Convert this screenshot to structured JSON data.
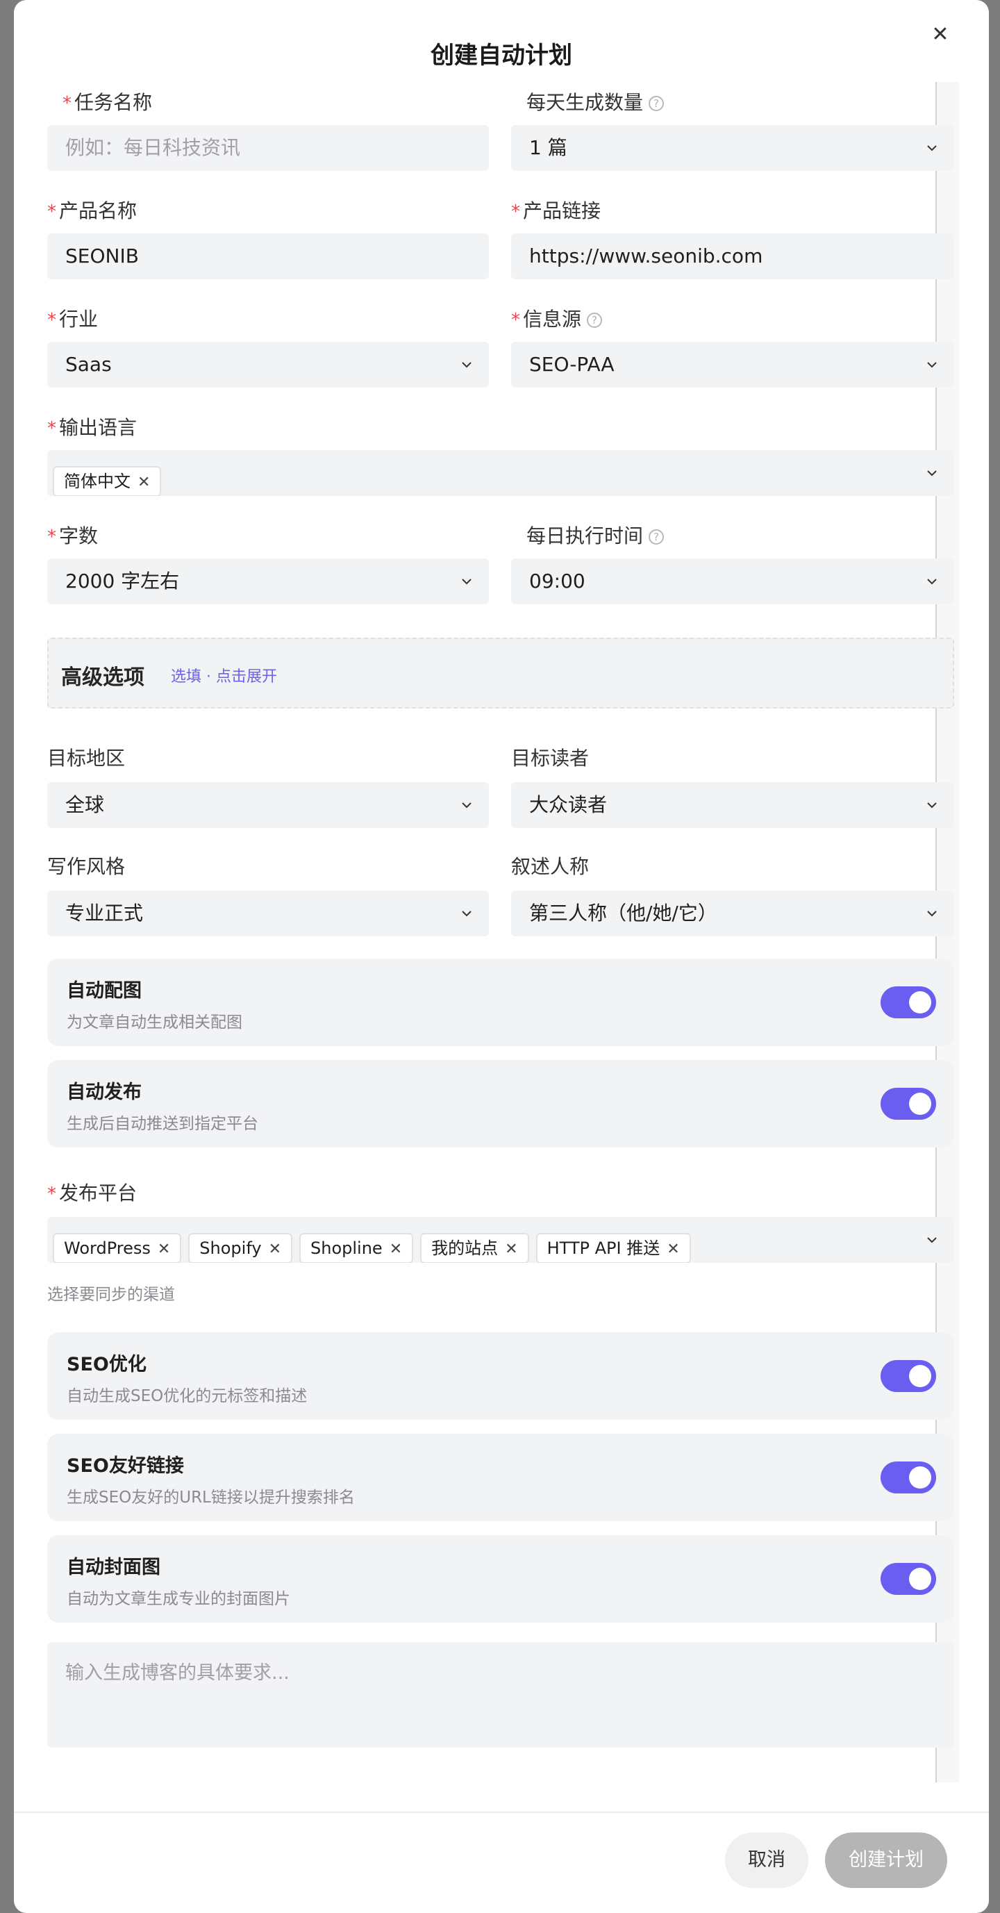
{
  "dialog": {
    "title": "创建自动计划",
    "close_icon": "close-icon"
  },
  "form": {
    "task_name": {
      "label": "任务名称",
      "placeholder": "例如：每日科技资讯"
    },
    "daily_count": {
      "label": "每天生成数量",
      "value": "1 篇"
    },
    "product_name": {
      "label": "产品名称",
      "value": "SEONIB"
    },
    "product_link": {
      "label": "产品链接",
      "value": "https://www.seonib.com"
    },
    "industry": {
      "label": "行业",
      "value": "Saas"
    },
    "source": {
      "label": "信息源",
      "value": "SEO-PAA"
    },
    "output_language": {
      "label": "输出语言",
      "tags": [
        "简体中文"
      ]
    },
    "word_count": {
      "label": "字数",
      "value": "2000 字左右"
    },
    "daily_time": {
      "label": "每日执行时间",
      "value": "09:00"
    }
  },
  "advanced": {
    "title": "高级选项",
    "hint": "选填 · 点击展开",
    "target_region": {
      "label": "目标地区",
      "value": "全球"
    },
    "target_reader": {
      "label": "目标读者",
      "value": "大众读者"
    },
    "writing_style": {
      "label": "写作风格",
      "value": "专业正式"
    },
    "narrator": {
      "label": "叙述人称",
      "value": "第三人称（他/她/它）"
    }
  },
  "toggles": [
    {
      "title": "自动配图",
      "subtitle": "为文章自动生成相关配图",
      "on": true
    },
    {
      "title": "自动发布",
      "subtitle": "生成后自动推送到指定平台",
      "on": true
    },
    {
      "title": "SEO优化",
      "subtitle": "自动生成SEO优化的元标签和描述",
      "on": true
    },
    {
      "title": "SEO友好链接",
      "subtitle": "生成SEO友好的URL链接以提升搜索排名",
      "on": true
    },
    {
      "title": "自动封面图",
      "subtitle": "自动为文章生成专业的封面图片",
      "on": true
    }
  ],
  "publish": {
    "label": "发布平台",
    "tags": [
      "WordPress",
      "Shopify",
      "Shopline",
      "我的站点",
      "HTTP API 推送"
    ],
    "hint": "选择要同步的渠道"
  },
  "requirements": {
    "placeholder": "输入生成博客的具体要求..."
  },
  "footer": {
    "cancel": "取消",
    "create": "创建计划"
  },
  "colors": {
    "accent": "#6a5ef0",
    "required": "#e5484d",
    "field_bg": "#f2f3f5"
  }
}
